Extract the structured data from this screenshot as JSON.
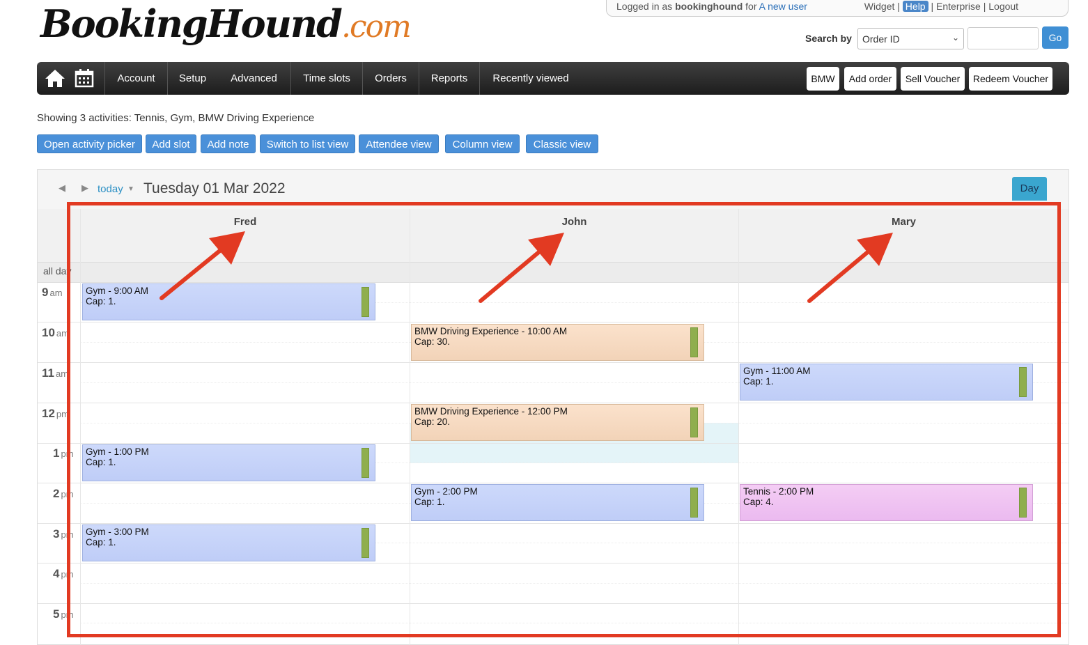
{
  "header": {
    "logo_main": "BookingHound",
    "logo_tld": ".com",
    "topbar": {
      "logged_in_prefix": "Logged in as ",
      "user": "bookinghound",
      "for_text": " for ",
      "new_user_link": "A new user",
      "widget": "Widget",
      "help": "Help",
      "enterprise": "Enterprise",
      "logout": "Logout"
    },
    "search": {
      "label": "Search by",
      "selected": "Order ID",
      "go_label": "Go"
    }
  },
  "nav": {
    "items": [
      "Account",
      "Setup",
      "Advanced",
      "Time slots",
      "Orders",
      "Reports",
      "Recently viewed"
    ],
    "right_buttons": [
      "BMW",
      "Add order",
      "Sell Voucher",
      "Redeem Voucher"
    ]
  },
  "activity": {
    "showing_text": "Showing 3 activities: Tennis, Gym, BMW Driving Experience",
    "buttons": [
      "Open activity picker",
      "Add slot",
      "Add note",
      "Switch to list view",
      "Attendee view",
      "Column view",
      "Classic view"
    ]
  },
  "calendar": {
    "today_label": "today",
    "date_title": "Tuesday 01 Mar 2022",
    "view_button": "Day",
    "all_day_label": "all day",
    "columns": [
      "Fred",
      "John",
      "Mary"
    ],
    "hours": [
      {
        "h": "9",
        "ampm": "am"
      },
      {
        "h": "10",
        "ampm": "am"
      },
      {
        "h": "11",
        "ampm": "am"
      },
      {
        "h": "12",
        "ampm": "pm"
      },
      {
        "h": "1",
        "ampm": "pm"
      },
      {
        "h": "2",
        "ampm": "pm"
      },
      {
        "h": "3",
        "ampm": "pm"
      },
      {
        "h": "4",
        "ampm": "pm"
      },
      {
        "h": "5",
        "ampm": "pm"
      }
    ],
    "events": [
      {
        "title": "Gym - 9:00 AM",
        "cap": "Cap: 1.",
        "column": "Fred"
      },
      {
        "title": "BMW Driving Experience - 10:00 AM",
        "cap": "Cap: 30.",
        "column": "John"
      },
      {
        "title": "Gym - 11:00 AM",
        "cap": "Cap: 1.",
        "column": "Mary"
      },
      {
        "title": "BMW Driving Experience - 12:00 PM",
        "cap": "Cap: 20.",
        "column": "John"
      },
      {
        "title": "Gym - 1:00 PM",
        "cap": "Cap: 1.",
        "column": "Fred"
      },
      {
        "title": "Gym - 2:00 PM",
        "cap": "Cap: 1.",
        "column": "John"
      },
      {
        "title": "Tennis - 2:00 PM",
        "cap": "Cap: 4.",
        "column": "Mary"
      },
      {
        "title": "Gym - 3:00 PM",
        "cap": "Cap: 1.",
        "column": "Fred"
      }
    ]
  },
  "colors": {
    "annotation_red": "#e23a22",
    "gym": "#c5d3f9",
    "bmw": "#f6dac2",
    "tennis": "#efc3f2",
    "capacity_bar": "#8fae4e",
    "button_blue": "#4a90d9"
  }
}
